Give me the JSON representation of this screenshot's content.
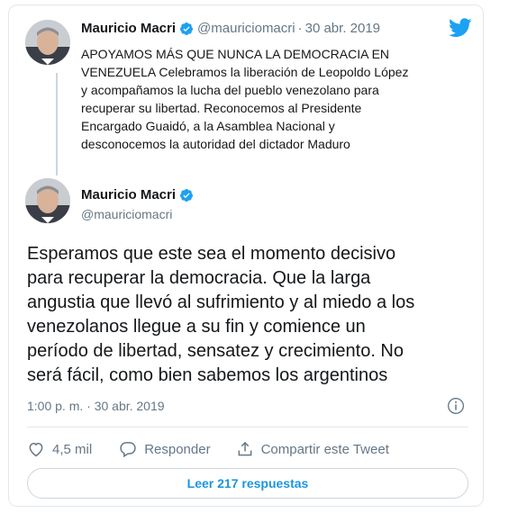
{
  "quoted_tweet": {
    "name": "Mauricio Macri",
    "handle": "@mauriciomacri",
    "separator": "·",
    "date": "30 abr. 2019",
    "lines": [
      "APOYAMOS MÁS QUE NUNCA LA DEMOCRACIA EN",
      "VENEZUELA Celebramos la liberación de Leopoldo López",
      "y acompañamos la lucha del pueblo venezolano para",
      "recuperar su libertad. Reconocemos al Presidente",
      "Encargado Guaidó, a la Asamblea Nacional y",
      "desconocemos la autoridad del dictador Maduro"
    ]
  },
  "main_tweet": {
    "name": "Mauricio Macri",
    "handle": "@mauriciomacri",
    "lines": [
      "Esperamos que este sea el momento decisivo",
      "para recuperar la democracia. Que la larga",
      "angustia que llevó al sufrimiento y al miedo a los",
      "venezolanos llegue a su fin y comience un",
      "período de libertad, sensatez y crecimiento. No",
      "será fácil, como bien sabemos los argentinos"
    ],
    "timestamp": "1:00 p. m. · 30 abr. 2019"
  },
  "actions": {
    "likes": "4,5 mil",
    "reply": "Responder",
    "share": "Compartir este Tweet"
  },
  "read_replies": "Leer 217 respuestas",
  "colors": {
    "brand_blue": "#1da1f2",
    "link_blue": "#1b95e0",
    "muted_gray": "#657786",
    "border": "#e1e8ed"
  },
  "icons": [
    "verified-badge-icon",
    "twitter-bird-icon",
    "info-icon",
    "heart-icon",
    "reply-icon",
    "share-icon"
  ]
}
